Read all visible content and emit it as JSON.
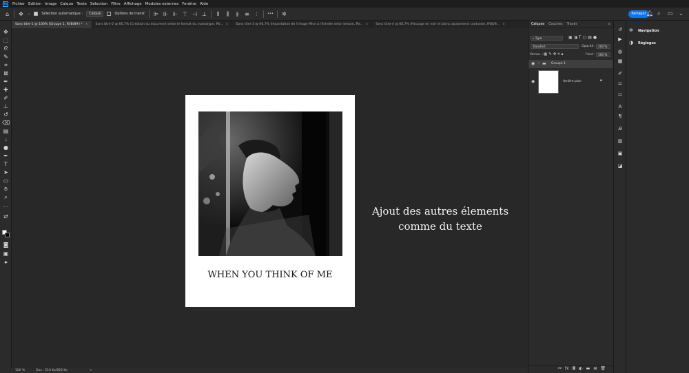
{
  "app": {
    "logo": "Ps"
  },
  "menu": [
    "Fichier",
    "Edition",
    "Image",
    "Calque",
    "Texte",
    "Sélection",
    "Filtre",
    "Affichage",
    "Modules externes",
    "Fenêtre",
    "Aide"
  ],
  "options": {
    "auto_select_label": "Sélection automatique :",
    "auto_select_value": "Calque",
    "transform_label": "Options de transf.",
    "more": "•••",
    "share": "Partager"
  },
  "tabs": [
    {
      "label": "Sans titre-1 @ 100% (Groupe 1, RVB/8#) *"
    },
    {
      "label": "Sans titre-2 @ 66,7% (Création du document selon le format du cyanotype, RV..."
    },
    {
      "label": "Sans titre-3 @ 66,7% (Importation de l'image Mise à l'échelle selon besoin, RV..."
    },
    {
      "label": "Sans titre-4 @ 66,7% (Passage en noir et blanc ajustement contraste, RVB/8..."
    }
  ],
  "canvas": {
    "poster_title": "WHEN YOU THINK OF ME",
    "annotation_line1": "Ajout des autres élements",
    "annotation_line2": "comme du texte"
  },
  "status": {
    "zoom": "100 %",
    "doc": "Doc : 519 Ko/826 Ko",
    "arrow": ">"
  },
  "layers_panel": {
    "tabs": [
      "Calques",
      "Couches",
      "Tracés"
    ],
    "filter": "Type",
    "blend_mode": "Transfert",
    "opacity_label": "Opacité :",
    "opacity_value": "100 %",
    "lock_label": "Verrou. :",
    "fill_label": "Fond :",
    "fill_value": "100 %",
    "layers": [
      {
        "name": "Groupe 1"
      },
      {
        "name": "Arrière-plan"
      }
    ]
  },
  "right_panel": {
    "items": [
      "Navigation",
      "Réglages"
    ]
  },
  "colors": {
    "accent": "#1473e6",
    "canvas_bg": "#282828",
    "panel_bg": "#2b2b2b"
  },
  "icons": [
    "move-icon",
    "marquee-icon",
    "lasso-icon",
    "quick-select-icon",
    "crop-icon",
    "eyedropper-icon",
    "healing-icon",
    "brush-icon",
    "stamp-icon",
    "history-brush-icon",
    "eraser-icon",
    "gradient-icon",
    "blur-icon",
    "dodge-icon",
    "pen-icon",
    "type-icon",
    "path-select-icon",
    "shape-icon",
    "hand-icon",
    "zoom-icon"
  ]
}
